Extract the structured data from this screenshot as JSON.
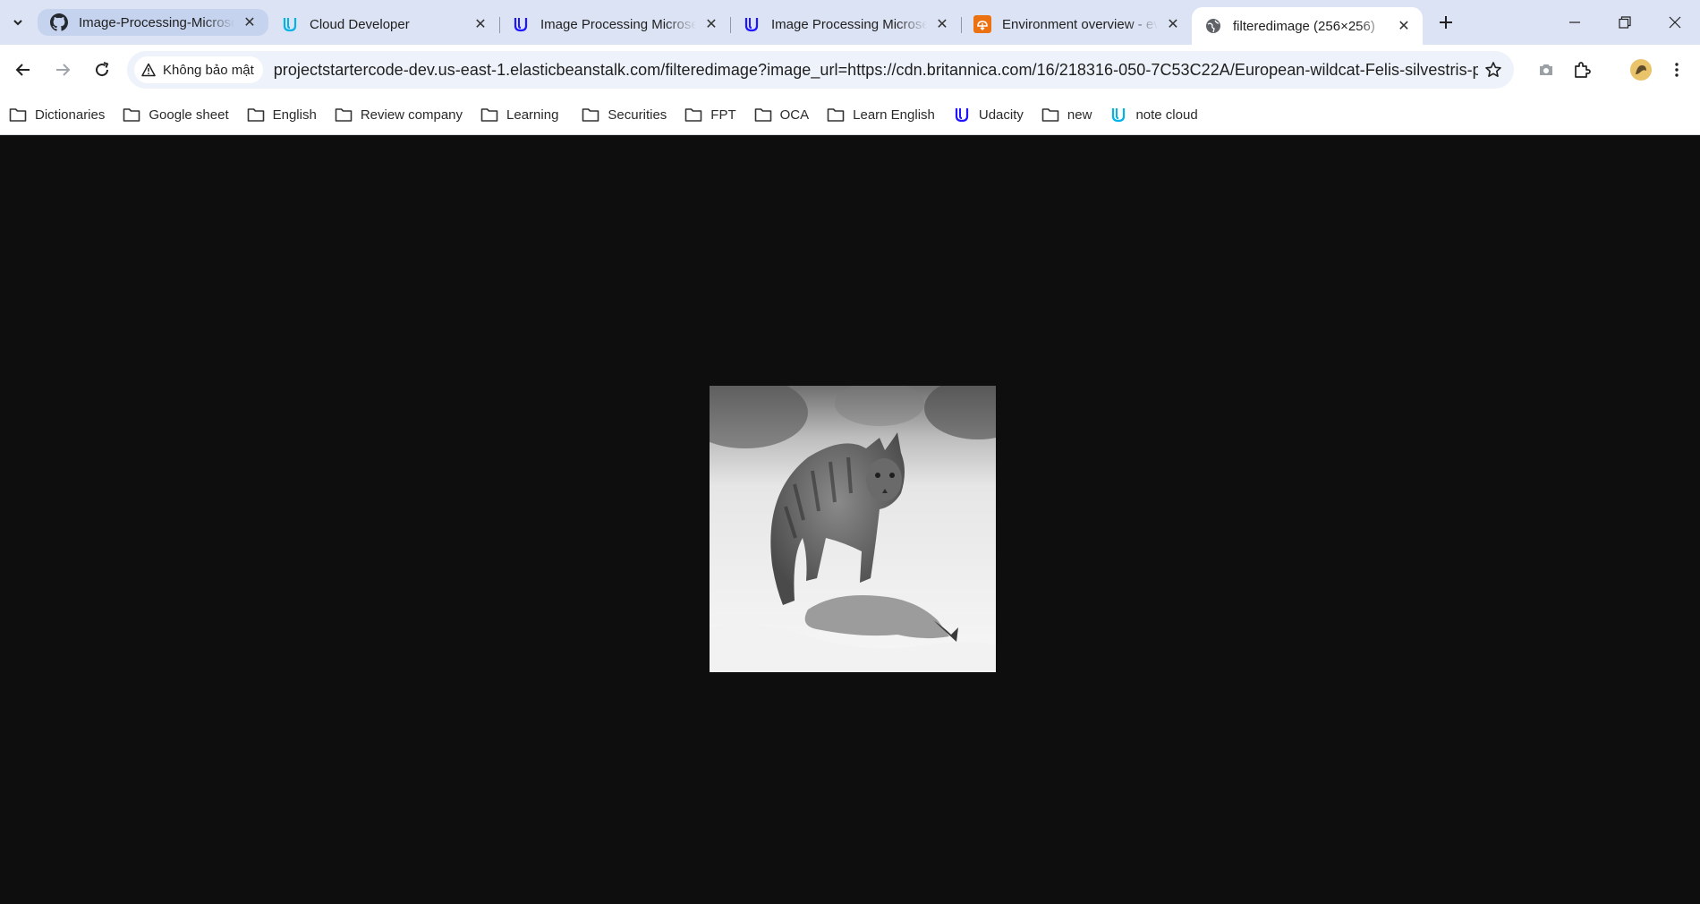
{
  "tabs": [
    {
      "title": "Image-Processing-Microservice",
      "favicon": "github-icon",
      "state": "hovered"
    },
    {
      "title": "Cloud Developer",
      "favicon": "udacity-icon",
      "state": "normal"
    },
    {
      "title": "Image Processing Microservice",
      "favicon": "udacity-icon",
      "state": "normal"
    },
    {
      "title": "Image Processing Microservice",
      "favicon": "udacity-icon",
      "state": "normal"
    },
    {
      "title": "Environment overview - eve",
      "favicon": "aws-elastic-beanstalk-icon",
      "state": "normal"
    },
    {
      "title": "filteredimage (256×256)",
      "favicon": "globe-icon",
      "state": "active"
    }
  ],
  "toolbar": {
    "security_label": "Không bảo mật",
    "url": "projectstartercode-dev.us-east-1.elasticbeanstalk.com/filteredimage?image_url=https://cdn.britannica.com/16/218316-050-7C53C22A/European-wildcat-Felis-silvestris-prey..."
  },
  "bookmarks": [
    {
      "label": "Dictionaries",
      "icon": "folder-icon"
    },
    {
      "label": "Google sheet",
      "icon": "folder-icon"
    },
    {
      "label": "English",
      "icon": "folder-icon"
    },
    {
      "label": "Review company",
      "icon": "folder-icon"
    },
    {
      "label": "Learning",
      "icon": "folder-icon"
    },
    {
      "label": "Securities",
      "icon": "folder-icon"
    },
    {
      "label": "FPT",
      "icon": "folder-icon"
    },
    {
      "label": "OCA",
      "icon": "folder-icon"
    },
    {
      "label": "Learn English",
      "icon": "folder-icon"
    },
    {
      "label": "Udacity",
      "icon": "udacity-icon"
    },
    {
      "label": "new",
      "icon": "folder-icon"
    },
    {
      "label": "note cloud",
      "icon": "udacity-icon"
    }
  ],
  "content": {
    "background": "#0e0e0e",
    "image_kind": "grayscale photo of a wildcat standing over prey in snow"
  },
  "colors": {
    "tabstrip": "#dbe3f4",
    "active_tab": "#ffffff",
    "omnibox": "#eef2fa",
    "udacity_blue": "#2015ff",
    "aws_orange": "#ec7211"
  }
}
